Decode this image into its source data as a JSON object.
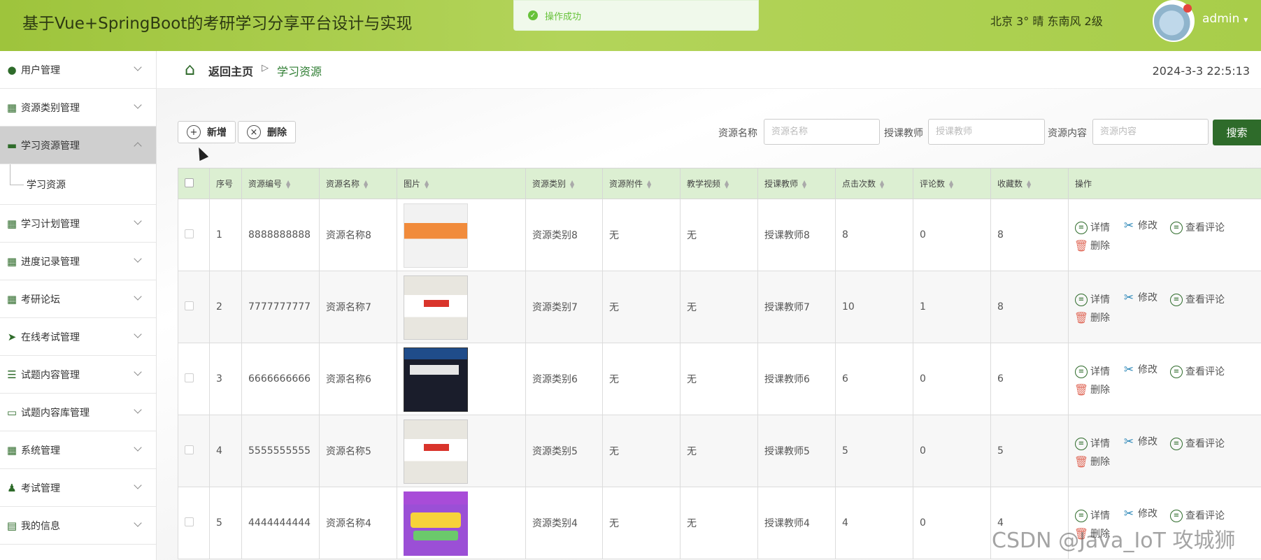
{
  "header": {
    "title": "基于Vue+SpringBoot的考研学习分享平台设计与实现",
    "weather": "北京  3°  晴  东南风  2级",
    "username": "admin",
    "avatar_icon": "avatar-icon"
  },
  "toast": {
    "message": "操作成功"
  },
  "sidebar": {
    "items": [
      {
        "label": "用户管理",
        "icon": "bulb-icon"
      },
      {
        "label": "资源类别管理",
        "icon": "grid-icon"
      },
      {
        "label": "学习资源管理",
        "icon": "wallet-icon",
        "active": true
      },
      {
        "label": "学习计划管理",
        "icon": "grid-icon"
      },
      {
        "label": "进度记录管理",
        "icon": "grid-icon"
      },
      {
        "label": "考研论坛",
        "icon": "grid-icon"
      },
      {
        "label": "在线考试管理",
        "icon": "paper-plane-icon"
      },
      {
        "label": "试题内容管理",
        "icon": "sliders-icon"
      },
      {
        "label": "试题内容库管理",
        "icon": "monitor-icon"
      },
      {
        "label": "系统管理",
        "icon": "grid-icon"
      },
      {
        "label": "考试管理",
        "icon": "user-icon"
      },
      {
        "label": "我的信息",
        "icon": "card-icon"
      }
    ],
    "sub_item": "学习资源"
  },
  "breadcrumb": {
    "home": "返回主页",
    "current": "学习资源",
    "datetime": "2024-3-3 22:5:13"
  },
  "toolbar": {
    "add_label": "新增",
    "delete_label": "删除"
  },
  "search": {
    "name_label": "资源名称",
    "name_placeholder": "资源名称",
    "teacher_label": "授课教师",
    "teacher_placeholder": "授课教师",
    "content_label": "资源内容",
    "content_placeholder": "资源内容",
    "button_label": "搜索"
  },
  "table": {
    "headers": [
      "序号",
      "资源编号",
      "资源名称",
      "图片",
      "资源类别",
      "资源附件",
      "教学视频",
      "授课教师",
      "点击次数",
      "评论数",
      "收藏数",
      "操作"
    ],
    "ops": {
      "detail": "详情",
      "edit": "修改",
      "comments": "查看评论",
      "delete": "删除"
    },
    "rows": [
      {
        "no": "1",
        "code": "8888888888",
        "name": "资源名称8",
        "category": "资源类别8",
        "attachment": "无",
        "video": "无",
        "teacher": "授课教师8",
        "clicks": "8",
        "comments": "0",
        "favorites": "8"
      },
      {
        "no": "2",
        "code": "7777777777",
        "name": "资源名称7",
        "category": "资源类别7",
        "attachment": "无",
        "video": "无",
        "teacher": "授课教师7",
        "clicks": "10",
        "comments": "1",
        "favorites": "8"
      },
      {
        "no": "3",
        "code": "6666666666",
        "name": "资源名称6",
        "category": "资源类别6",
        "attachment": "无",
        "video": "无",
        "teacher": "授课教师6",
        "clicks": "6",
        "comments": "0",
        "favorites": "6"
      },
      {
        "no": "4",
        "code": "5555555555",
        "name": "资源名称5",
        "category": "资源类别5",
        "attachment": "无",
        "video": "无",
        "teacher": "授课教师5",
        "clicks": "5",
        "comments": "0",
        "favorites": "5"
      },
      {
        "no": "5",
        "code": "4444444444",
        "name": "资源名称4",
        "category": "资源类别4",
        "attachment": "无",
        "video": "无",
        "teacher": "授课教师4",
        "clicks": "4",
        "comments": "0",
        "favorites": "4"
      }
    ]
  },
  "watermark": "CSDN @Java_IoT 攻城狮",
  "colors": {
    "header_green": "#a8cd4a",
    "accent_green": "#2e6b2a",
    "table_header_bg": "#dcefd2",
    "toast_green": "#67c23a"
  }
}
